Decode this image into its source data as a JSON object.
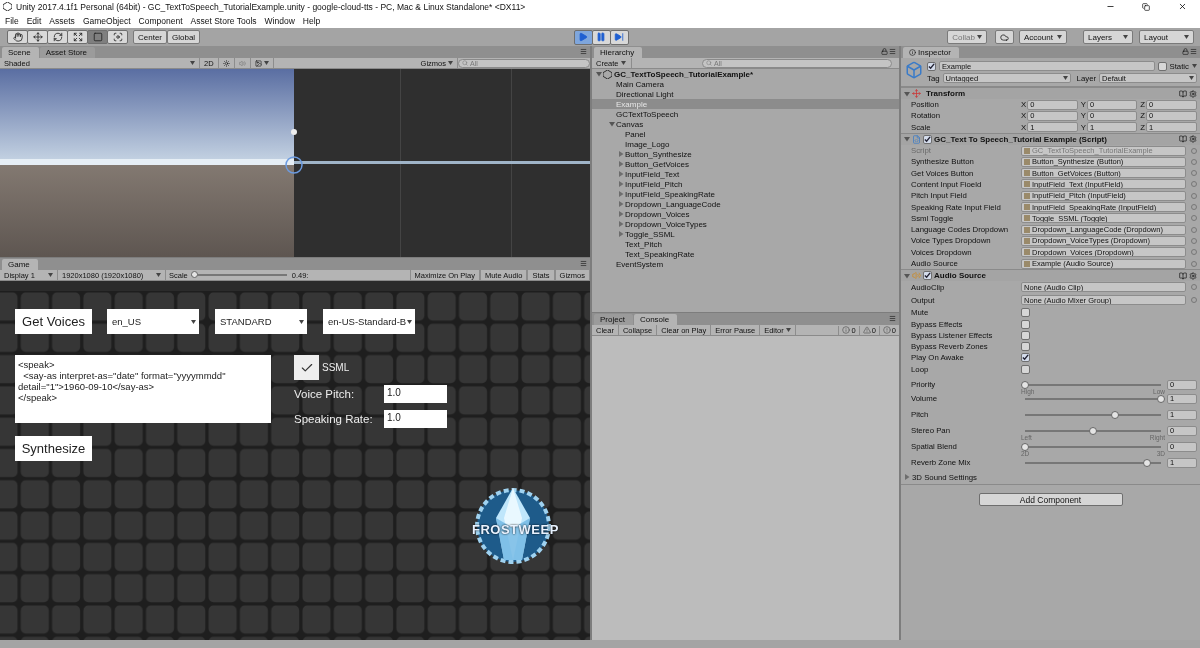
{
  "window": {
    "title": "Unity 2017.4.1f1 Personal (64bit) - GC_TextToSpeech_TutorialExample.unity - google-cloud-tts - PC, Mac & Linux Standalone* <DX11>"
  },
  "menu": [
    "File",
    "Edit",
    "Assets",
    "GameObject",
    "Component",
    "Asset Store Tools",
    "Window",
    "Help"
  ],
  "toolbar": {
    "tools": [
      {
        "kind": "hand",
        "selected": false
      },
      {
        "kind": "move",
        "selected": false
      },
      {
        "kind": "rotate",
        "selected": false
      },
      {
        "kind": "scale",
        "selected": false
      },
      {
        "kind": "rect",
        "selected": true
      },
      {
        "kind": "transform",
        "selected": false
      }
    ],
    "pivot": "Center",
    "space": "Global",
    "playback": [
      {
        "kind": "play",
        "selected": true
      },
      {
        "kind": "pause",
        "selected": false
      },
      {
        "kind": "step",
        "selected": false
      }
    ],
    "collab": "Collab",
    "account": "Account",
    "layers": "Layers",
    "layout": "Layout"
  },
  "scene": {
    "tabs": [
      {
        "label": "Scene",
        "selected": true
      },
      {
        "label": "Asset Store",
        "selected": false
      }
    ],
    "shading": "Shaded",
    "mode_2d": "2D",
    "gizmos": "Gizmos",
    "search_placeholder": "All"
  },
  "game": {
    "tab": "Game",
    "display": "Display 1",
    "resolution": "1920x1080 (1920x1080)",
    "scale_label": "Scale",
    "scale": {
      "level": 0.0
    },
    "scale_reading": "0.49:",
    "toggles": [
      "Maximize On Play",
      "Mute Audio",
      "Stats",
      "Gizmos"
    ],
    "get_voices": "Get Voices",
    "dropdowns": [
      "en_US",
      "STANDARD",
      "en-US-Standard-B"
    ],
    "text": "<speak>\n  <say-as interpret-as=\"date\" format=\"yyyymmdd\"\ndetail=\"1\">1960-09-10</say-as>\n</speak>",
    "ssml": {
      "label": "SSML",
      "checked": true
    },
    "pitch": {
      "label": "Voice Pitch:",
      "value": "1.0"
    },
    "rate": {
      "label": "Speaking Rate:",
      "value": "1.0"
    },
    "synthesize": "Synthesize",
    "logo": "FROSTWEEP"
  },
  "hierarchy": {
    "tab": "Hierarchy",
    "create": "Create",
    "search_placeholder": "All",
    "scene": {
      "label": "GC_TextToSpeech_TutorialExample*",
      "expanded": true,
      "children": [
        {
          "label": "Main Camera",
          "kind": "leaf",
          "selected": false
        },
        {
          "label": "Directional Light",
          "kind": "leaf",
          "selected": false
        },
        {
          "label": "Example",
          "kind": "leaf",
          "selected": true
        },
        {
          "label": "GCTextToSpeech",
          "kind": "leaf",
          "selected": false
        },
        {
          "label": "Canvas",
          "kind": "group",
          "expanded": true,
          "selected": false,
          "children": [
            {
              "label": "Panel",
              "kind": "leaf",
              "selected": false
            },
            {
              "label": "Image_Logo",
              "kind": "leaf",
              "selected": false
            },
            {
              "label": "Button_Synthesize",
              "kind": "group",
              "expanded": false,
              "selected": false
            },
            {
              "label": "Button_GetVoices",
              "kind": "group",
              "expanded": false,
              "selected": false
            },
            {
              "label": "InputField_Text",
              "kind": "group",
              "expanded": false,
              "selected": false
            },
            {
              "label": "InputField_Pitch",
              "kind": "group",
              "expanded": false,
              "selected": false
            },
            {
              "label": "InputField_SpeakingRate",
              "kind": "group",
              "expanded": false,
              "selected": false
            },
            {
              "label": "Dropdown_LanguageCode",
              "kind": "group",
              "expanded": false,
              "selected": false
            },
            {
              "label": "Dropdown_Voices",
              "kind": "group",
              "expanded": false,
              "selected": false
            },
            {
              "label": "Dropdown_VoiceTypes",
              "kind": "group",
              "expanded": false,
              "selected": false
            },
            {
              "label": "Toggle_SSML",
              "kind": "group",
              "expanded": false,
              "selected": false
            },
            {
              "label": "Text_Pitch",
              "kind": "leaf",
              "selected": false
            },
            {
              "label": "Text_SpeakingRate",
              "kind": "leaf",
              "selected": false
            }
          ]
        },
        {
          "label": "EventSystem",
          "kind": "leaf",
          "selected": false
        }
      ]
    }
  },
  "console": {
    "tabs": [
      {
        "label": "Project",
        "selected": false
      },
      {
        "label": "Console",
        "selected": true
      }
    ],
    "buttons": [
      "Clear",
      "Collapse",
      "Clear on Play",
      "Error Pause",
      "Editor"
    ],
    "counts": [
      {
        "kind": "info",
        "value": "0"
      },
      {
        "kind": "warning",
        "value": "0"
      },
      {
        "kind": "error",
        "value": "0"
      }
    ]
  },
  "inspector": {
    "tab": "Inspector",
    "object": {
      "name": "Example",
      "active": true,
      "static_label": "Static",
      "static": false,
      "tag_label": "Tag",
      "tag": "Untagged",
      "layer_label": "Layer",
      "layer": "Default"
    },
    "transform": {
      "title": "Transform",
      "expanded": true,
      "rows": [
        {
          "label": "Position",
          "values": [
            {
              "axis": "X",
              "value": "0"
            },
            {
              "axis": "Y",
              "value": "0"
            },
            {
              "axis": "Z",
              "value": "0"
            }
          ]
        },
        {
          "label": "Rotation",
          "values": [
            {
              "axis": "X",
              "value": "0"
            },
            {
              "axis": "Y",
              "value": "0"
            },
            {
              "axis": "Z",
              "value": "0"
            }
          ]
        },
        {
          "label": "Scale",
          "values": [
            {
              "axis": "X",
              "value": "1"
            },
            {
              "axis": "Y",
              "value": "1"
            },
            {
              "axis": "Z",
              "value": "1"
            }
          ]
        }
      ]
    },
    "script": {
      "title": "GC_Text To Speech_Tutorial Example (Script)",
      "expanded": true,
      "enabled": true,
      "fields": [
        {
          "label": "Script",
          "value": "GC_TextToSpeech_TutorialExample",
          "disabled": true
        },
        {
          "label": "Synthesize Button",
          "value": "Button_Synthesize (Button)",
          "disabled": false
        },
        {
          "label": "Get Voices Button",
          "value": "Button_GetVoices (Button)",
          "disabled": false
        },
        {
          "label": "Content Input Fioeld",
          "value": "InputField_Text (InputField)",
          "disabled": false
        },
        {
          "label": "Pitch Input Field",
          "value": "InputField_Pitch (InputField)",
          "disabled": false
        },
        {
          "label": "Speaking Rate Input Field",
          "value": "InputField_SpeakingRate (InputField)",
          "disabled": false
        },
        {
          "label": "Ssml Toggle",
          "value": "Toggle_SSML (Toggle)",
          "disabled": false
        },
        {
          "label": "Language Codes Dropdown",
          "value": "Dropdown_LanguageCode (Dropdown)",
          "disabled": false
        },
        {
          "label": "Voice Types Dropdown",
          "value": "Dropdown_VoiceTypes (Dropdown)",
          "disabled": false
        },
        {
          "label": "Voices Dropdown",
          "value": "Dropdown_Voices (Dropdown)",
          "disabled": false
        },
        {
          "label": "Audio Source",
          "value": "Example (Audio Source)",
          "disabled": false
        }
      ]
    },
    "audio_source": {
      "title": "Audio Source",
      "expanded": true,
      "enabled": true,
      "rows": [
        {
          "kind": "object",
          "label": "AudioClip",
          "value": "None (Audio Clip)"
        },
        {
          "kind": "object",
          "label": "Output",
          "value": "None (Audio Mixer Group)"
        },
        {
          "kind": "check",
          "label": "Mute",
          "checked": false
        },
        {
          "kind": "check",
          "label": "Bypass Effects",
          "checked": false
        },
        {
          "kind": "check",
          "label": "Bypass Listener Effects",
          "checked": false
        },
        {
          "kind": "check",
          "label": "Bypass Reverb Zones",
          "checked": false
        },
        {
          "kind": "check",
          "label": "Play On Awake",
          "checked": true
        },
        {
          "kind": "check",
          "label": "Loop",
          "checked": false
        },
        {
          "kind": "slider",
          "label": "Priority",
          "level": 0,
          "value": "0",
          "min_label": "High",
          "max_label": "Low"
        },
        {
          "kind": "slider",
          "label": "Volume",
          "level": 1,
          "value": "1"
        },
        {
          "kind": "slider",
          "label": "Pitch",
          "level": 0.66,
          "value": "1"
        },
        {
          "kind": "slider",
          "label": "Stereo Pan",
          "level": 0.5,
          "value": "0",
          "min_label": "Left",
          "max_label": "Right"
        },
        {
          "kind": "slider",
          "label": "Spatial Blend",
          "level": 0,
          "value": "0",
          "min_label": "2D",
          "max_label": "3D"
        },
        {
          "kind": "slider",
          "label": "Reverb Zone Mix",
          "level": 0.9,
          "value": "1"
        }
      ]
    },
    "sound_settings": {
      "label": "3D Sound Settings",
      "expanded": false
    },
    "add_component": "Add Component"
  }
}
